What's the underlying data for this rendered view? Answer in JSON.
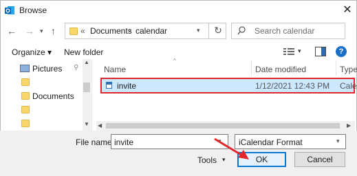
{
  "window": {
    "title": "Browse"
  },
  "address": {
    "overflow": "«",
    "crumbs": [
      "Documents",
      "calendar"
    ],
    "separator": "›"
  },
  "search": {
    "placeholder": "Search calendar"
  },
  "toolbar": {
    "organize": "Organize ▾",
    "new_folder": "New folder"
  },
  "nav": {
    "items": [
      "Pictures",
      "",
      "Documents",
      "",
      ""
    ]
  },
  "columns": {
    "name": "Name",
    "date": "Date modified",
    "type": "Type"
  },
  "files": [
    {
      "name": "invite",
      "date": "1/12/2021 12:43 PM",
      "type": "Cale"
    }
  ],
  "footer": {
    "file_name_label": "File name:",
    "file_name_value": "invite",
    "file_type": "iCalendar Format",
    "tools": "Tools",
    "ok": "OK",
    "cancel": "Cancel"
  },
  "colors": {
    "selection": "#cce8ff",
    "highlight": "#e0262b",
    "accent": "#0078d7"
  }
}
